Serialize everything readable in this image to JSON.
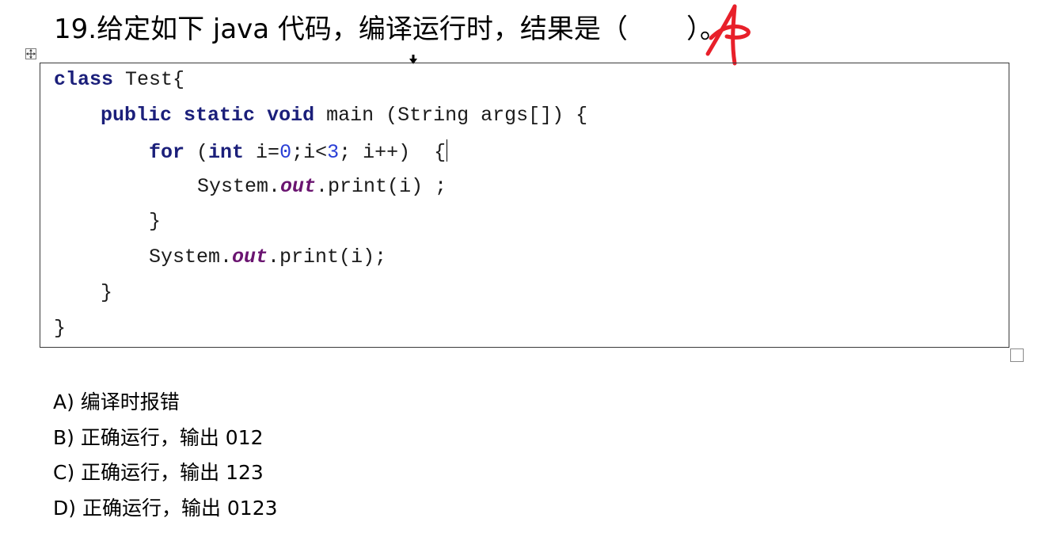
{
  "question": {
    "number": "19.",
    "text": "给定如下 java 代码，编译运行时，结果是（",
    "close": "）。",
    "handwritten_answer": "A"
  },
  "code": {
    "line1": {
      "kw": "class",
      "rest": " Test{"
    },
    "line2": {
      "kw1": "public",
      "kw2": "static",
      "kw3": "void",
      "rest": " main (String args[]) {"
    },
    "line3": {
      "kw1": "for",
      "p1": " (",
      "kw2": "int",
      "p2": " i=",
      "n1": "0",
      "p3": ";i<",
      "n2": "3",
      "p4": "; i++)  {"
    },
    "line4": {
      "p1": "System.",
      "field": "out",
      "p2": ".print(i) ;"
    },
    "line5": {
      "text": "}"
    },
    "line6": {
      "p1": "System.",
      "field": "out",
      "p2": ".print(i);"
    },
    "line7": {
      "text": "}"
    },
    "line8": {
      "text": "}"
    }
  },
  "options": [
    {
      "label": "A) 编译时报错"
    },
    {
      "label": "B) 正确运行，输出 012"
    },
    {
      "label": "C) 正确运行，输出 123"
    },
    {
      "label": "D) 正确运行，输出 0123"
    }
  ],
  "colors": {
    "keyword": "#1b1f7a",
    "number": "#2a3fd6",
    "field": "#6a1470",
    "handwriting": "#e8202a"
  },
  "icons": {
    "table_move_handle": "table-move-icon",
    "column_select_arrow": "down-arrow-icon",
    "table_resize_handle": "table-resize-icon"
  }
}
